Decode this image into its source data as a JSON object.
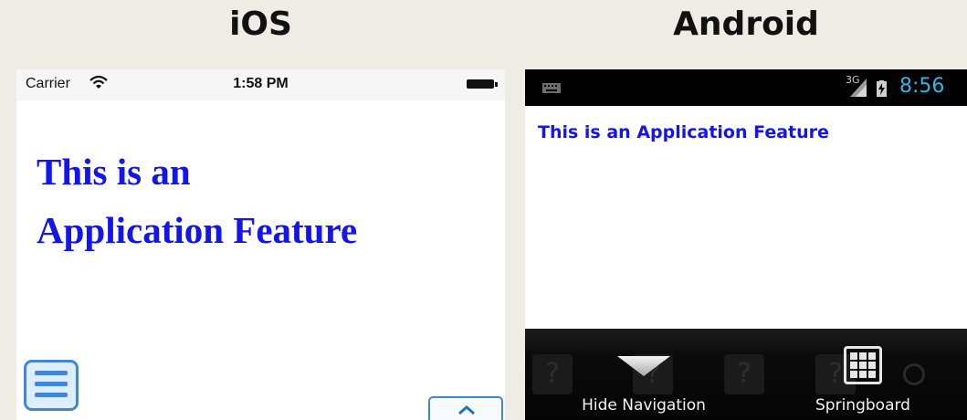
{
  "labels": {
    "ios": "iOS",
    "android": "Android"
  },
  "ios": {
    "status": {
      "carrier": "Carrier",
      "time": "1:58 PM"
    },
    "content": {
      "line1": "This is an",
      "line2": "Application Feature"
    }
  },
  "android": {
    "status": {
      "network": "3G",
      "time": "8:56"
    },
    "content": {
      "heading": "This is an Application Feature"
    },
    "navbar": {
      "hide_label": "Hide Navigation",
      "springboard_label": "Springboard"
    }
  },
  "colors": {
    "heading_blue": "#1414ee",
    "ios_accent": "#3f88d8",
    "android_time": "#33b5e5"
  }
}
